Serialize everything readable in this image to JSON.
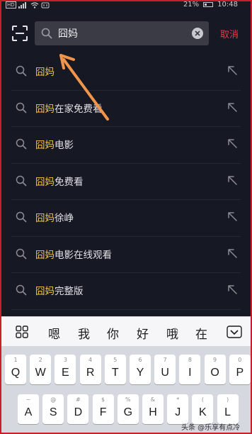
{
  "status_bar": {
    "network": "HD",
    "network_speed": "",
    "battery": "21%",
    "time": "10:48"
  },
  "header": {
    "search_value": "囧妈",
    "cancel_label": "取消"
  },
  "suggestions": [
    {
      "highlight": "囧妈",
      "rest": ""
    },
    {
      "highlight": "囧妈",
      "rest": "在家免费看"
    },
    {
      "highlight": "囧妈",
      "rest": "电影"
    },
    {
      "highlight": "囧妈",
      "rest": "免费看"
    },
    {
      "highlight": "囧妈",
      "rest": "徐峥"
    },
    {
      "highlight": "囧妈",
      "rest": "电影在线观看"
    },
    {
      "highlight": "囧妈",
      "rest": "完整版"
    }
  ],
  "keyboard": {
    "candidates": [
      "嗯",
      "我",
      "你",
      "好",
      "哦",
      "在"
    ],
    "row1": [
      {
        "main": "Q",
        "sub": "1"
      },
      {
        "main": "W",
        "sub": "2"
      },
      {
        "main": "E",
        "sub": "3"
      },
      {
        "main": "R",
        "sub": "4"
      },
      {
        "main": "T",
        "sub": "5"
      },
      {
        "main": "Y",
        "sub": "6"
      },
      {
        "main": "U",
        "sub": "7"
      },
      {
        "main": "I",
        "sub": "8"
      },
      {
        "main": "O",
        "sub": "9"
      },
      {
        "main": "P",
        "sub": "0"
      }
    ],
    "row2": [
      {
        "main": "A",
        "sub": "~"
      },
      {
        "main": "S",
        "sub": "@"
      },
      {
        "main": "D",
        "sub": "#"
      },
      {
        "main": "F",
        "sub": "$"
      },
      {
        "main": "G",
        "sub": "%"
      },
      {
        "main": "H",
        "sub": "&"
      },
      {
        "main": "J",
        "sub": "*"
      },
      {
        "main": "K",
        "sub": "("
      },
      {
        "main": "L",
        "sub": ")"
      }
    ]
  },
  "watermark": "头条 @乐享有点冷",
  "colors": {
    "background": "#161823",
    "highlight": "#f6c444",
    "cancel": "#e83a4d",
    "annotation_arrow": "#f0954a"
  }
}
